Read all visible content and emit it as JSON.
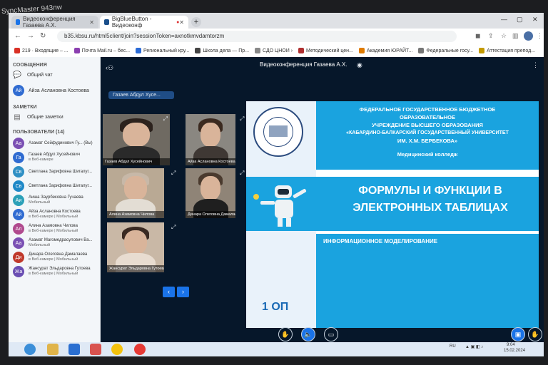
{
  "monitor_brand": "SyncMaster 943nw",
  "browser": {
    "tabs": [
      {
        "label": "Видеоконференция Газаева А.Х.",
        "active": false
      },
      {
        "label": "BigBlueButton - Видеоконф",
        "active": true
      }
    ],
    "url": "b35.kbsu.ru/html5client/join?sessionToken=axnotkmvdamtorzm",
    "bookmarks": [
      "219 · Входящие – ...",
      "Почта Mail.ru – бес...",
      "Региональный кру...",
      "Школа дела — Пр...",
      "СДО ЦНОИ ›",
      "Методический цен...",
      "Академия ЮРАЙТ...",
      "Федеральные госу...",
      "Аттестация препод..."
    ]
  },
  "sidebar": {
    "messages_header": "СООБЩЕНИЯ",
    "public_chat": "Общий чат",
    "private_chat": {
      "initials": "Ай",
      "name": "Айза Аслановна Костоева"
    },
    "notes_header": "ЗАМЕТКИ",
    "shared_notes": "Общие заметки",
    "users_header": "ПОЛЬЗОВАТЕЛИ (14)",
    "users": [
      {
        "initials": "Аа",
        "name": "Азамат Сейфудинович Гу... (Вы)",
        "status": "",
        "color": "#7a4fb3"
      },
      {
        "initials": "Га",
        "name": "Газаев Абдул Хусейнович",
        "status": "в Веб-камере",
        "color": "#2f6bd1"
      },
      {
        "initials": "Св",
        "name": "Светлана Зарифовна Шигалуг...",
        "status": "",
        "color": "#2f8fc4"
      },
      {
        "initials": "Св",
        "name": "Светлана Зарифовна Шигалуг...",
        "status": "",
        "color": "#1e88c7"
      },
      {
        "initials": "Аи",
        "name": "Аиша Заурбековна Гучаева",
        "status": "Мобильный",
        "color": "#2ba0b8"
      },
      {
        "initials": "Ай",
        "name": "Айза Аслановна Костоева",
        "status": "в Веб-камере | Мобильный",
        "color": "#2f6bd1"
      },
      {
        "initials": "Ал",
        "name": "Алина Азамовна Чилова",
        "status": "в Веб-камере | Мобильный",
        "color": "#b04a8e"
      },
      {
        "initials": "Аа",
        "name": "Азамат Магомедрасулович Ва...",
        "status": "Мобильный",
        "color": "#7a4fb3"
      },
      {
        "initials": "Ди",
        "name": "Динара Олеговна Дамалаева",
        "status": "в Веб-камере | Мобильный",
        "color": "#c0392b"
      },
      {
        "initials": "Жа",
        "name": "Жансурат Эльдаровна Гутоева",
        "status": "в Веб-камере | Мобильный",
        "color": "#6a4fb3"
      }
    ]
  },
  "conference": {
    "title": "Видеоконференция Газаева А.Х.",
    "presenter": "Газаев Абдул Хусе...",
    "videos": [
      "Газаев Абдул Хусейнович",
      "Айза Аслановна Костоева",
      "Алина Азамовна Чилова",
      "Динара Олеговна Дамалаева",
      "Жансурат Эльдаровна Гутоева"
    ],
    "prev_label": "‹",
    "next_label": "›"
  },
  "slide": {
    "header_lines": [
      "ФЕДЕРАЛЬНОЕ ГОСУДАРСТВЕННОЕ БЮДЖЕТНОЕ",
      "ОБРАЗОВАТЕЛЬНОЕ",
      "УЧРЕЖДЕНИЕ ВЫСШЕГО ОБРАЗОВАНИЯ",
      "«КАБАРДИНО-БАЛКАРСКИЙ ГОСУДАРСТВЕННЫЙ УНИВЕРСИТЕТ",
      "ИМ. Х.М. БЕРБЕКОВА»"
    ],
    "college": "Медицинский колледж",
    "title_line1": "ФОРМУЛЫ И ФУНКЦИИ В",
    "title_line2": "ЭЛЕКТРОННЫХ ТАБЛИЦАХ",
    "subtitle": "ИНФОРМАЦИОННОЕ МОДЕЛИРОВАНИЕ",
    "group": "1 ОП"
  },
  "taskbar": {
    "lang": "RU",
    "time": "9:04",
    "date": "15.02.2024"
  }
}
